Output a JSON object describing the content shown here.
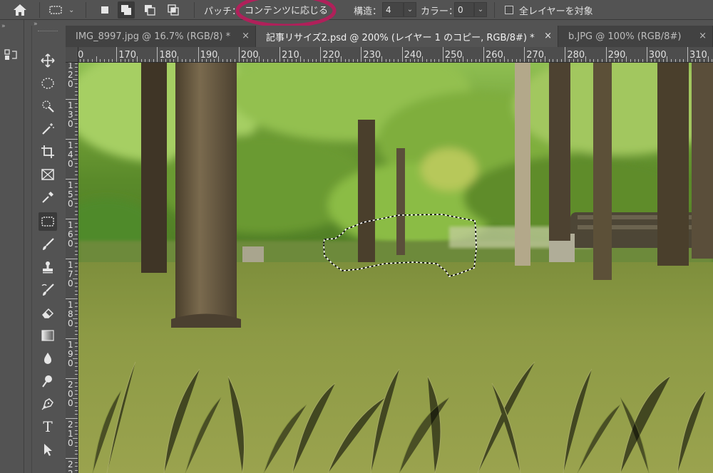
{
  "options_bar": {
    "patch_label": "パッチ：",
    "patch_mode": "コンテンツに応じる",
    "structure_label": "構造：",
    "structure_value": "4",
    "color_label": "カラー：",
    "color_value": "0",
    "all_layers_label": "全レイヤーを対象",
    "all_layers_checked": false,
    "highlight_color": "#b0205a"
  },
  "tabs": [
    {
      "label": "IMG_8997.jpg @ 16.7% (RGB/8) *",
      "active": false
    },
    {
      "label": "記事リサイズ2.psd @ 200% (レイヤー 1 のコピー, RGB/8#) *",
      "active": true
    },
    {
      "label": "b.JPG @ 100% (RGB/8#)",
      "active": false
    }
  ],
  "close_glyph": "×",
  "ruler": {
    "h_labels": [
      "0",
      "170",
      "180",
      "190",
      "200",
      "210",
      "220",
      "230",
      "240",
      "250",
      "260",
      "270",
      "280",
      "290",
      "300",
      "310"
    ],
    "v_labels": [
      "120",
      "130",
      "140",
      "150",
      "160",
      "170",
      "180",
      "190",
      "200",
      "210",
      "220"
    ]
  },
  "tools": [
    "move-tool-icon",
    "ellipse-marquee-icon",
    "quick-selection-icon",
    "magic-wand-icon",
    "crop-icon",
    "frame-icon",
    "eyedropper-icon",
    "patch-tool-icon",
    "brush-icon",
    "clone-stamp-icon",
    "history-brush-icon",
    "eraser-icon",
    "gradient-icon",
    "blur-icon",
    "dodge-icon",
    "pen-icon",
    "type-icon",
    "path-selection-icon"
  ],
  "type_tool_glyph": "T",
  "colors": {
    "panel": "#535353",
    "tab_bar": "#424242",
    "ruler": "#4d4d4d",
    "grass": "#8d9a45",
    "foliage": "#5f8a2c"
  }
}
